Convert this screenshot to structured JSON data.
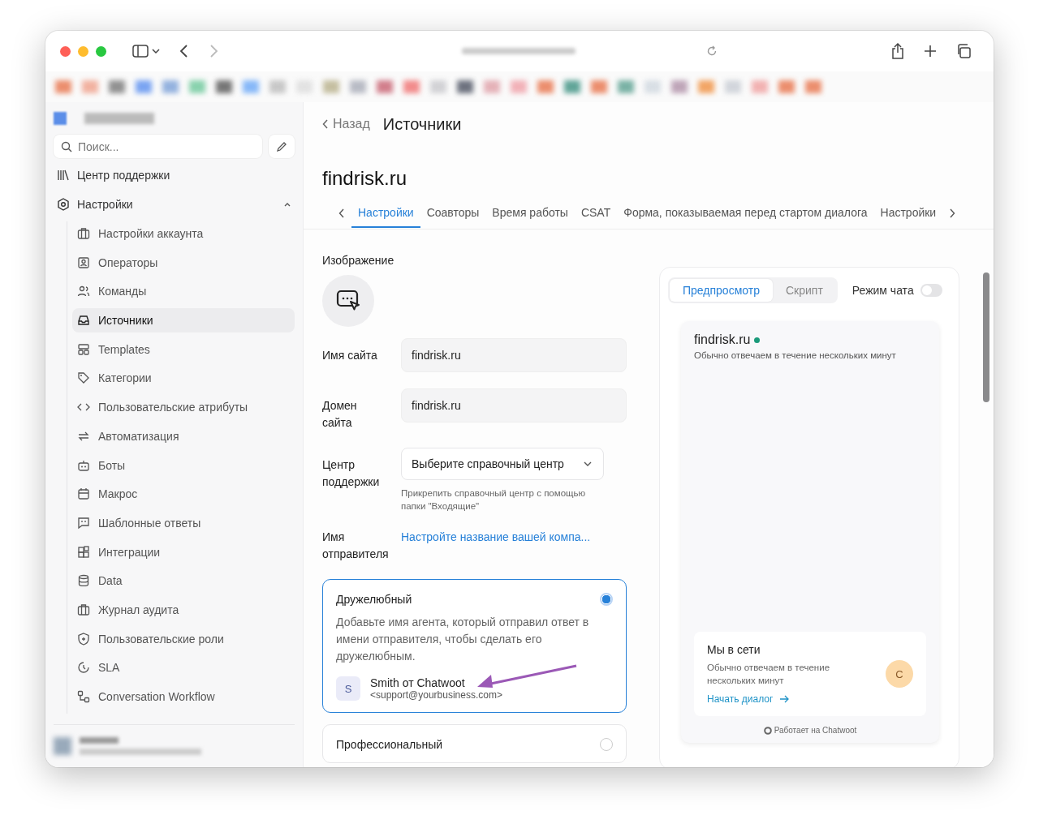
{
  "sidebar": {
    "search": {
      "placeholder": "Поиск..."
    },
    "help_center": {
      "label": "Центр поддержки"
    },
    "settings": {
      "label": "Настройки",
      "expanded": true,
      "children": [
        {
          "label": "Настройки аккаунта",
          "selected": false
        },
        {
          "label": "Операторы",
          "selected": false
        },
        {
          "label": "Команды",
          "selected": false
        },
        {
          "label": "Источники",
          "selected": true
        },
        {
          "label": "Templates",
          "selected": false
        },
        {
          "label": "Категории",
          "selected": false
        },
        {
          "label": "Пользовательские атрибуты",
          "selected": false
        },
        {
          "label": "Автоматизация",
          "selected": false
        },
        {
          "label": "Боты",
          "selected": false
        },
        {
          "label": "Макрос",
          "selected": false
        },
        {
          "label": "Шаблонные ответы",
          "selected": false
        },
        {
          "label": "Интеграции",
          "selected": false
        },
        {
          "label": "Data",
          "selected": false
        },
        {
          "label": "Журнал аудита",
          "selected": false
        },
        {
          "label": "Пользовательские роли",
          "selected": false
        },
        {
          "label": "SLA",
          "selected": false
        },
        {
          "label": "Conversation Workflow",
          "selected": false
        }
      ]
    }
  },
  "header": {
    "back": "Назад",
    "title": "Источники"
  },
  "inbox_name": "findrisk.ru",
  "tabs": [
    {
      "label": "Настройки",
      "selected": true
    },
    {
      "label": "Соавторы",
      "selected": false
    },
    {
      "label": "Время работы",
      "selected": false
    },
    {
      "label": "CSAT",
      "selected": false
    },
    {
      "label": "Форма, показываемая перед стартом диалога",
      "selected": false
    },
    {
      "label": "Настройки",
      "selected": false
    }
  ],
  "form": {
    "image_label": "Изображение",
    "fields": [
      {
        "kind": "input",
        "label": "Имя сайта",
        "value": "findrisk.ru"
      },
      {
        "kind": "input",
        "label": "Домен сайта",
        "value": "findrisk.ru"
      },
      {
        "kind": "select",
        "label": "Центр поддержки",
        "value": "Выберите справочный центр",
        "hint": "Прикрепить справочный центр с помощью папки \"Входящие\""
      },
      {
        "kind": "link",
        "label": "Имя отправителя",
        "value": "Настройте название вашей компа..."
      }
    ],
    "sender_options": [
      {
        "title": "Дружелюбный",
        "selected": true,
        "description": "Добавьте имя агента, который отправил ответ в имени отправителя, чтобы сделать его дружелюбным.",
        "avatar": "S",
        "sample_name": "Smith от Chatwoot",
        "sample_email": "<support@yourbusiness.com>"
      },
      {
        "title": "Профессиональный",
        "selected": false
      }
    ]
  },
  "preview": {
    "tabs": [
      {
        "label": "Предпросмотр",
        "selected": true
      },
      {
        "label": "Скрипт",
        "selected": false
      }
    ],
    "chat_mode": {
      "label": "Режим чата",
      "on": false
    },
    "widget": {
      "name": "findrisk.ru",
      "online": true,
      "subtitle": "Обычно отвечаем в течение нескольких минут",
      "card_title": "Мы в сети",
      "card_text": "Обычно отвечаем в течение нескольких минут",
      "avatar": "C",
      "cta": "Начать диалог",
      "footer": "Работает на Chatwoot"
    }
  }
}
